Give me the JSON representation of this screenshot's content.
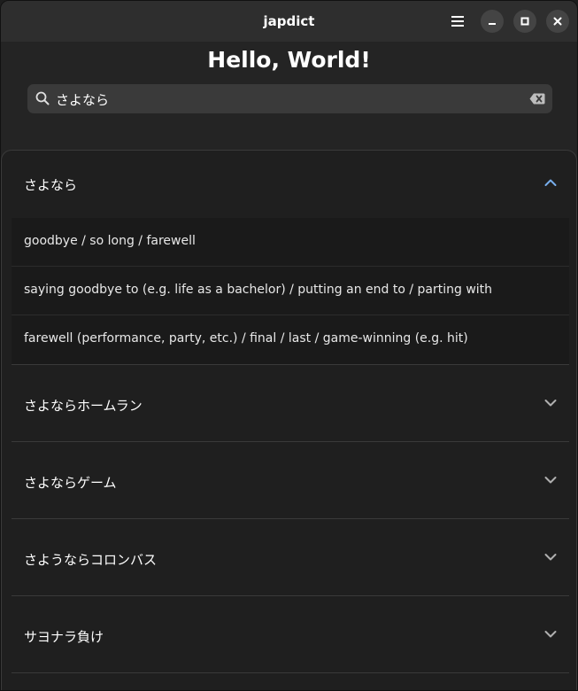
{
  "window": {
    "title": "japdict"
  },
  "page": {
    "heading": "Hello, World!"
  },
  "search": {
    "value": "さよなら"
  },
  "icons": {
    "menu": "hamburger-menu-icon",
    "minimize": "minimize-icon",
    "maximize": "maximize-icon",
    "close": "close-icon",
    "search": "search-icon",
    "clear": "clear-text-icon",
    "expanded": "chevron-up-icon",
    "collapsed": "chevron-down-icon"
  },
  "colors": {
    "accent": "#78aeed",
    "chevron": "#b0b0b0"
  },
  "entries": [
    {
      "word": "さよなら",
      "expanded": true,
      "definitions": [
        "goodbye / so long / farewell",
        "saying goodbye to (e.g. life as a bachelor) / putting an end to / parting with",
        "farewell (performance, party, etc.) / final / last / game-winning (e.g. hit)"
      ]
    },
    {
      "word": "さよならホームラン",
      "expanded": false
    },
    {
      "word": "さよならゲーム",
      "expanded": false
    },
    {
      "word": "さようならコロンバス",
      "expanded": false
    },
    {
      "word": "サヨナラ負け",
      "expanded": false
    }
  ]
}
